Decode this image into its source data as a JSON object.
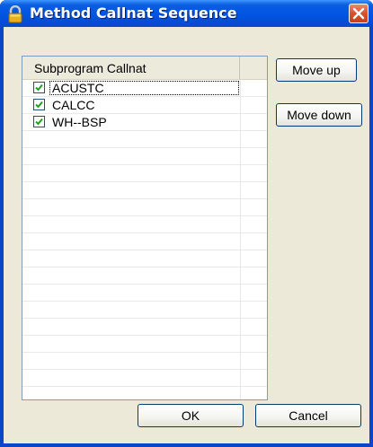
{
  "window": {
    "title": "Method Callnat Sequence"
  },
  "icons": {
    "title_icon": "padlock-icon",
    "close_icon": "close-x-icon",
    "check_icon": "checkmark-icon"
  },
  "colors": {
    "titlebar": "#0054e3",
    "close_button": "#d5532b",
    "dialog_bg": "#ece9d8",
    "checkbox_border": "#1c5180",
    "check_mark": "#21a121"
  },
  "list": {
    "column_header": "Subprogram Callnat",
    "items": [
      {
        "label": "ACUSTC",
        "checked": true
      },
      {
        "label": "CALCC",
        "checked": true
      },
      {
        "label": "WH--BSP",
        "checked": true
      }
    ]
  },
  "buttons": {
    "move_up": "Move up",
    "move_down": "Move down",
    "ok": "OK",
    "cancel": "Cancel"
  }
}
